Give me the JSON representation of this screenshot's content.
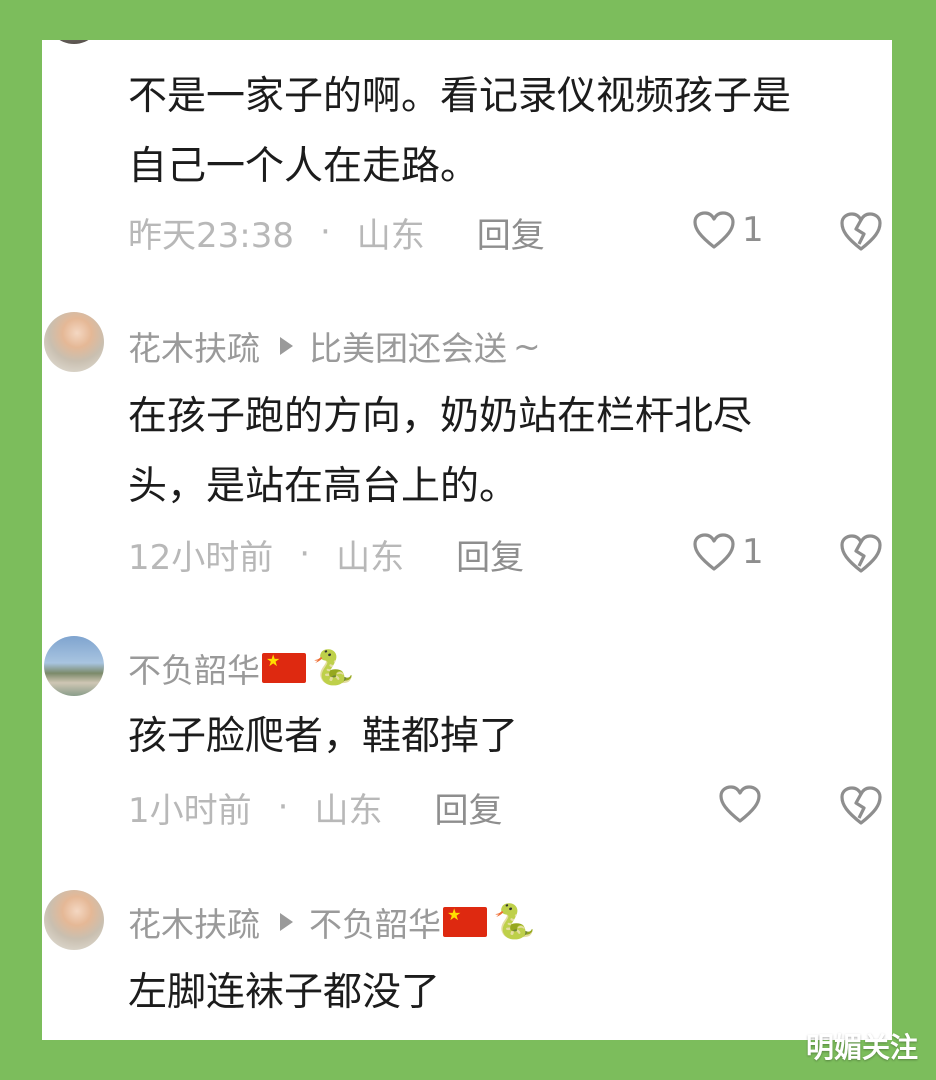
{
  "comments": [
    {
      "body_lines": [
        "不是一家子的啊。看记录仪视频孩子是",
        "自己一个人在走路。"
      ],
      "time": "昨天23:38",
      "location": "山东",
      "reply_label": "回复",
      "likes": "1"
    },
    {
      "author": "花木扶疏",
      "reply_to": "比美团还会送",
      "reply_to_suffix": "~",
      "body_lines": [
        "在孩子跑的方向，奶奶站在栏杆北尽",
        "头，是站在高台上的。"
      ],
      "time": "12小时前",
      "location": "山东",
      "reply_label": "回复",
      "likes": "1"
    },
    {
      "author": "不负韶华",
      "body_lines": [
        "孩子脸爬者，鞋都掉了"
      ],
      "time": "1小时前",
      "location": "山东",
      "reply_label": "回复",
      "likes": ""
    },
    {
      "author": "花木扶疏",
      "reply_to": "不负韶华",
      "body_lines": [
        "左脚连袜子都没了"
      ]
    }
  ],
  "separator": "·",
  "watermark": "明媚关注",
  "colors": {
    "frame": "#7cbd5c",
    "panel": "#ffffff",
    "body_text": "#1c1c1c",
    "meta_text": "#b8b8b8",
    "name_text": "#9a9a9a",
    "icon": "#8e8e8e"
  },
  "icons": [
    "heart-outline-icon",
    "broken-heart-icon",
    "play-triangle-icon",
    "china-flag-icon",
    "snake-emoji-icon"
  ]
}
